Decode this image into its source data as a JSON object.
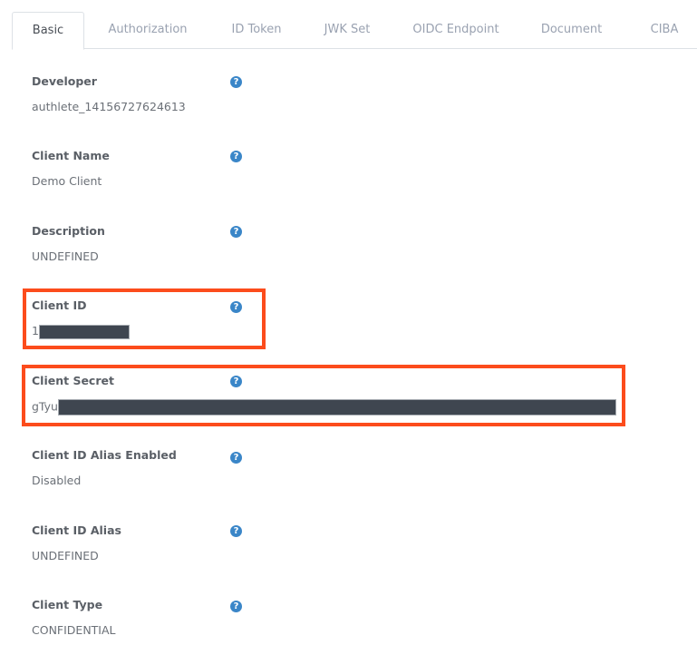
{
  "tabs": [
    {
      "label": "Basic",
      "active": true
    },
    {
      "label": "Authorization",
      "active": false
    },
    {
      "label": "ID Token",
      "active": false
    },
    {
      "label": "JWK Set",
      "active": false
    },
    {
      "label": "OIDC Endpoint",
      "active": false
    },
    {
      "label": "Document",
      "active": false
    },
    {
      "label": "CIBA",
      "active": false
    }
  ],
  "fields": [
    {
      "label": "Developer",
      "value": "authlete_14156727624613"
    },
    {
      "label": "Client Name",
      "value": "Demo Client"
    },
    {
      "label": "Description",
      "value": "UNDEFINED"
    },
    {
      "label": "Client ID",
      "value": "1",
      "redacted": true
    },
    {
      "label": "Client Secret",
      "value": "gTyu",
      "redacted": true
    },
    {
      "label": "Client ID Alias Enabled",
      "value": "Disabled"
    },
    {
      "label": "Client ID Alias",
      "value": "UNDEFINED"
    },
    {
      "label": "Client Type",
      "value": "CONFIDENTIAL"
    }
  ],
  "help_icon_glyph": "?",
  "colors": {
    "highlight": "#fc4c1c",
    "help_icon": "#3a86c8",
    "redaction": "#3f4650"
  }
}
